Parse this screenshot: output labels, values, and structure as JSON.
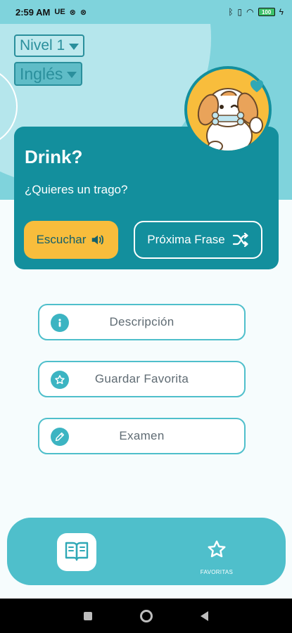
{
  "status_bar": {
    "time": "2:59 AM",
    "left_icons": [
      "ue-icon",
      "settings-alt-icon",
      "signal-alt-icon"
    ],
    "right_icons": [
      "bluetooth-icon",
      "vibrate-icon",
      "wifi-icon",
      "charging-icon"
    ],
    "battery": "100"
  },
  "selectors": {
    "level": "Nivel 1",
    "language": "Inglés"
  },
  "card": {
    "phrase": "Drink?",
    "translation": "¿Quieres un trago?",
    "listen_label": "Escuchar",
    "next_label": "Próxima Frase"
  },
  "actions": [
    {
      "label": "Descripción",
      "icon": "info-icon"
    },
    {
      "label": "Guardar Favorita",
      "icon": "star-icon"
    },
    {
      "label": "Examen",
      "icon": "pencil-icon"
    }
  ],
  "bottom_nav": {
    "book_icon": "book-icon",
    "favorites_label": "FAVORITAS"
  },
  "colors": {
    "header_bg": "#7fd3dc",
    "card_bg": "#138f9d",
    "accent_yellow": "#f8bd3c",
    "button_border": "#4fbfcb",
    "nav_bg": "#4fbfcb"
  }
}
